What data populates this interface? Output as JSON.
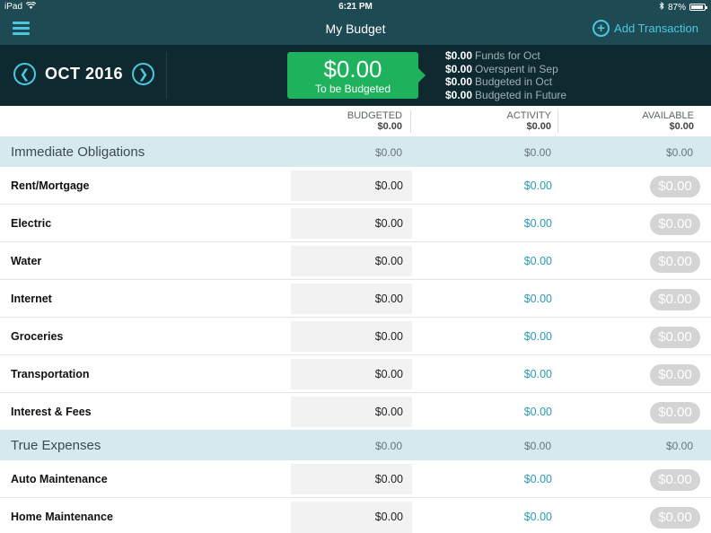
{
  "status_bar": {
    "device": "iPad",
    "time": "6:21 PM",
    "battery": "87%"
  },
  "nav": {
    "title": "My Budget",
    "add_label": "Add Transaction"
  },
  "header": {
    "month": "OCT 2016",
    "to_be_budgeted": {
      "amount": "$0.00",
      "label": "To be Budgeted"
    },
    "summary": [
      {
        "amount": "$0.00",
        "label": "Funds for Oct"
      },
      {
        "amount": "$0.00",
        "label": "Overspent in Sep"
      },
      {
        "amount": "$0.00",
        "label": "Budgeted in Oct"
      },
      {
        "amount": "$0.00",
        "label": "Budgeted in Future"
      }
    ]
  },
  "columns": {
    "budgeted": {
      "label": "BUDGETED",
      "total": "$0.00"
    },
    "activity": {
      "label": "ACTIVITY",
      "total": "$0.00"
    },
    "available": {
      "label": "AVAILABLE",
      "total": "$0.00"
    }
  },
  "groups": [
    {
      "name": "Immediate Obligations",
      "budgeted": "$0.00",
      "activity": "$0.00",
      "available": "$0.00",
      "categories": [
        {
          "name": "Rent/Mortgage",
          "budgeted": "$0.00",
          "activity": "$0.00",
          "available": "$0.00"
        },
        {
          "name": "Electric",
          "budgeted": "$0.00",
          "activity": "$0.00",
          "available": "$0.00"
        },
        {
          "name": "Water",
          "budgeted": "$0.00",
          "activity": "$0.00",
          "available": "$0.00"
        },
        {
          "name": "Internet",
          "budgeted": "$0.00",
          "activity": "$0.00",
          "available": "$0.00"
        },
        {
          "name": "Groceries",
          "budgeted": "$0.00",
          "activity": "$0.00",
          "available": "$0.00"
        },
        {
          "name": "Transportation",
          "budgeted": "$0.00",
          "activity": "$0.00",
          "available": "$0.00"
        },
        {
          "name": "Interest & Fees",
          "budgeted": "$0.00",
          "activity": "$0.00",
          "available": "$0.00"
        }
      ]
    },
    {
      "name": "True Expenses",
      "budgeted": "$0.00",
      "activity": "$0.00",
      "available": "$0.00",
      "categories": [
        {
          "name": "Auto Maintenance",
          "budgeted": "$0.00",
          "activity": "$0.00",
          "available": "$0.00"
        },
        {
          "name": "Home Maintenance",
          "budgeted": "$0.00",
          "activity": "$0.00",
          "available": "$0.00"
        }
      ]
    }
  ],
  "colors": {
    "nav_bg": "#1e4a54",
    "header_bg": "#0f2931",
    "accent": "#4cc7de",
    "to_be_budgeted": "#1fb25c",
    "group_bg": "#d6e9ee",
    "activity_text": "#2a9ab0",
    "available_pill": "#d4d4d4"
  }
}
